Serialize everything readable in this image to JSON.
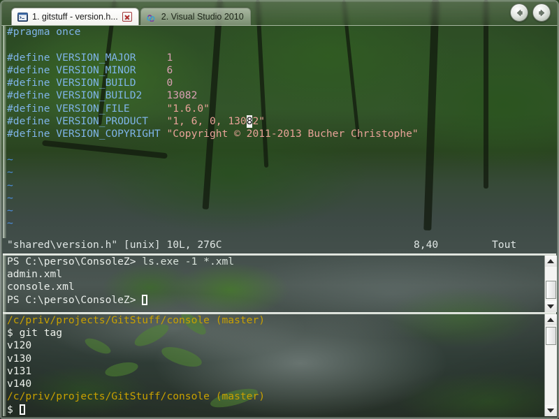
{
  "window": {
    "app": "ConsoleZ",
    "nav": {
      "back_icon": "arrow-left-icon",
      "forward_icon": "arrow-right-icon"
    }
  },
  "tabs": [
    {
      "index": "1",
      "label": "1. gitstuff - version.h...",
      "icon": "console-window-icon",
      "active": true,
      "close_label": "x"
    },
    {
      "index": "2",
      "label": "2. Visual Studio 2010",
      "icon": "visual-studio-infinity-icon",
      "active": false
    }
  ],
  "vim_pane": {
    "lines": [
      {
        "kind": "code",
        "segments": [
          {
            "t": "#pragma once",
            "c": "pre"
          }
        ]
      },
      {
        "kind": "blank",
        "segments": []
      },
      {
        "kind": "code",
        "segments": [
          {
            "t": "#define VERSION_MAJOR",
            "c": "pre"
          },
          {
            "t": "     ",
            "c": "plain"
          },
          {
            "t": "1",
            "c": "num"
          }
        ]
      },
      {
        "kind": "code",
        "segments": [
          {
            "t": "#define VERSION_MINOR",
            "c": "pre"
          },
          {
            "t": "     ",
            "c": "plain"
          },
          {
            "t": "6",
            "c": "num"
          }
        ]
      },
      {
        "kind": "code",
        "segments": [
          {
            "t": "#define VERSION_BUILD",
            "c": "pre"
          },
          {
            "t": "     ",
            "c": "plain"
          },
          {
            "t": "0",
            "c": "num"
          }
        ]
      },
      {
        "kind": "code",
        "segments": [
          {
            "t": "#define VERSION_BUILD2",
            "c": "pre"
          },
          {
            "t": "    ",
            "c": "plain"
          },
          {
            "t": "13082",
            "c": "num"
          }
        ]
      },
      {
        "kind": "code",
        "segments": [
          {
            "t": "#define VERSION_FILE",
            "c": "pre"
          },
          {
            "t": "      ",
            "c": "plain"
          },
          {
            "t": "\"1.6.0\"",
            "c": "str"
          }
        ]
      },
      {
        "kind": "code_cursor",
        "segments": [
          {
            "t": "#define VERSION_PRODUCT",
            "c": "pre"
          },
          {
            "t": "   ",
            "c": "plain"
          },
          {
            "t": "\"1, 6, 0, 130",
            "c": "str"
          },
          {
            "t": "8",
            "c": "cursor"
          },
          {
            "t": "2\"",
            "c": "str"
          }
        ]
      },
      {
        "kind": "code",
        "segments": [
          {
            "t": "#define VERSION_COPYRIGHT",
            "c": "pre"
          },
          {
            "t": " ",
            "c": "plain"
          },
          {
            "t": "\"Copyright © 2011-2013 Bucher Christophe\"",
            "c": "str"
          }
        ]
      },
      {
        "kind": "blank",
        "segments": []
      },
      {
        "kind": "tilde",
        "segments": [
          {
            "t": "~",
            "c": "tilde"
          }
        ]
      },
      {
        "kind": "tilde",
        "segments": [
          {
            "t": "~",
            "c": "tilde"
          }
        ]
      },
      {
        "kind": "tilde",
        "segments": [
          {
            "t": "~",
            "c": "tilde"
          }
        ]
      },
      {
        "kind": "tilde",
        "segments": [
          {
            "t": "~",
            "c": "tilde"
          }
        ]
      },
      {
        "kind": "tilde",
        "segments": [
          {
            "t": "~",
            "c": "tilde"
          }
        ]
      },
      {
        "kind": "tilde",
        "segments": [
          {
            "t": "~",
            "c": "tilde"
          }
        ]
      },
      {
        "kind": "blank",
        "segments": []
      }
    ],
    "status": {
      "file": "\"shared\\version.h\" [unix] 10L, 276C",
      "cursor_pos": "8,40",
      "scroll_pct": "Tout"
    }
  },
  "ps_pane": {
    "lines": [
      {
        "kind": "prompt_cmd",
        "prompt": "PS C:\\perso\\ConsoleZ>",
        "cmd": " ls.exe -1 *.xml"
      },
      {
        "kind": "out",
        "text": "admin.xml"
      },
      {
        "kind": "out",
        "text": "console.xml"
      },
      {
        "kind": "prompt_cursor",
        "prompt": "PS C:\\perso\\ConsoleZ>",
        "cmd": " "
      }
    ],
    "scrollbar": {
      "up_icon": "scroll-up-arrow-icon",
      "down_icon": "scroll-down-arrow-icon"
    }
  },
  "git_pane": {
    "lines": [
      {
        "kind": "path",
        "text": "/c/priv/projects/GitStuff/console (master)"
      },
      {
        "kind": "cmd",
        "text": "$ git tag"
      },
      {
        "kind": "out",
        "text": "v120"
      },
      {
        "kind": "out",
        "text": "v130"
      },
      {
        "kind": "out",
        "text": "v131"
      },
      {
        "kind": "out",
        "text": "v140"
      },
      {
        "kind": "path",
        "text": "/c/priv/projects/GitStuff/console (master)"
      },
      {
        "kind": "cmd_cursor",
        "text": "$ "
      }
    ],
    "scrollbar": {
      "up_icon": "scroll-up-arrow-icon",
      "down_icon": "scroll-down-arrow-icon"
    }
  },
  "colors": {
    "preprocessor": "#7fb4e8",
    "number": "#dba0b4",
    "string": "#e8a398",
    "tilde": "#4c8fe0",
    "git_path": "#c8a000",
    "terminal_text": "#eef2ec"
  }
}
